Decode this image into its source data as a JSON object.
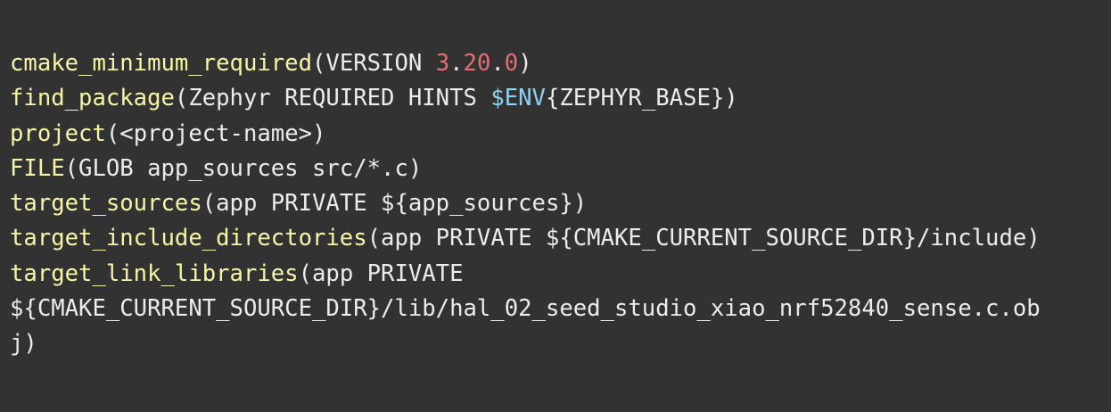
{
  "code": {
    "lines": [
      {
        "fn": "cmake_minimum_required",
        "a": "(VERSION ",
        "num_major": "3",
        "dot1": ".",
        "num_minor": "20",
        "dot2": ".",
        "num_patch": "0",
        "b": ")"
      },
      {
        "fn": "find_package",
        "a": "(Zephyr REQUIRED HINTS ",
        "env_var": "$ENV",
        "b": "{ZEPHYR_BASE})"
      },
      {
        "fn": "project",
        "a": "(<project-name>)"
      },
      {
        "fn": "FILE",
        "a": "(GLOB app_sources src/*.c)"
      },
      {
        "fn": "target_sources",
        "a": "(app PRIVATE ${app_sources})"
      },
      {
        "fn": "target_include_directories",
        "a": "(app PRIVATE ${CMAKE_CURRENT_SOURCE_DIR}/include)"
      },
      {
        "fn": "target_link_libraries",
        "a": "(app PRIVATE"
      },
      {
        "a": "${CMAKE_CURRENT_SOURCE_DIR}/lib/hal_02_seed_studio_xiao_nrf52840_sense.c.ob"
      },
      {
        "a": "j)"
      }
    ]
  },
  "colors": {
    "background": "#323232",
    "function": "#f8f6a6",
    "number": "#e46f72",
    "env_variable": "#8cd2f4",
    "text": "#ececec"
  }
}
